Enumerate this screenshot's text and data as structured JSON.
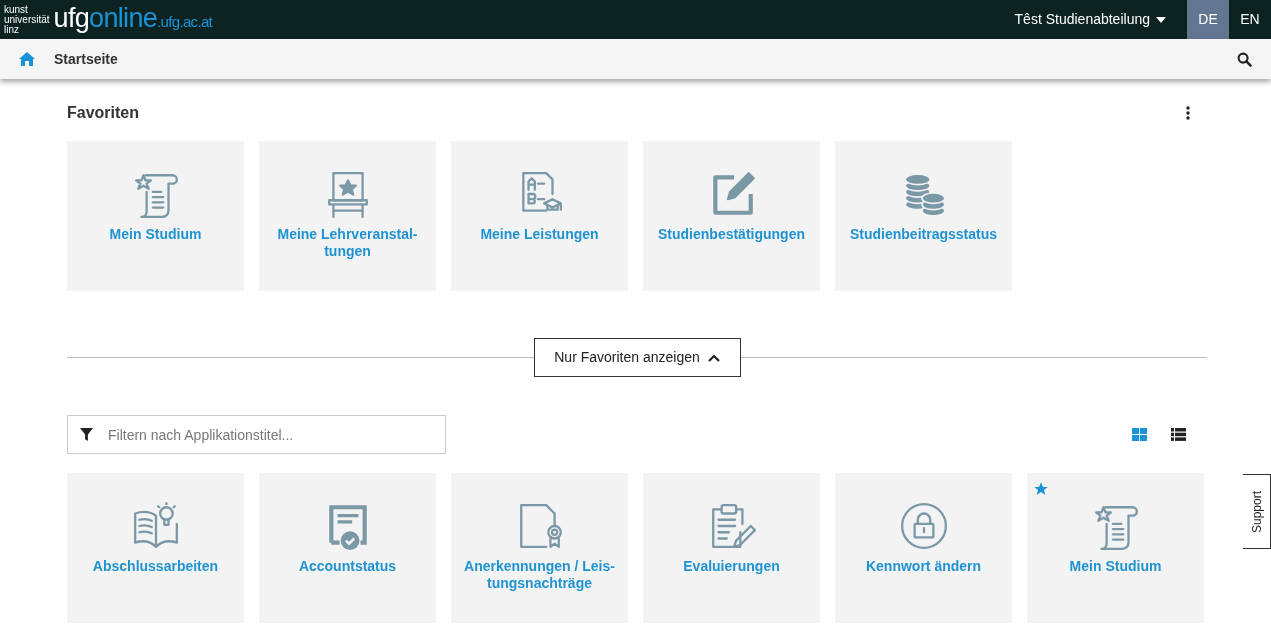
{
  "header": {
    "logo_small": "kunst\nuniversität\nlinz",
    "logo_main_a": "ufg",
    "logo_main_b": "online",
    "logo_domain": ".ufg.ac.at",
    "user": "Têst Studienabteilung",
    "languages": [
      {
        "label": "DE",
        "selected": true
      },
      {
        "label": "EN",
        "selected": false
      }
    ]
  },
  "nav": {
    "title": "Startseite"
  },
  "favorites": {
    "title": "Favoriten",
    "tiles": [
      {
        "label": "Mein Studium",
        "favorite": false
      },
      {
        "label": "Meine Lehrveranstal-\ntungen",
        "favorite": false
      },
      {
        "label": "Meine Leistungen",
        "favorite": false
      },
      {
        "label": "Studienbestätigungen",
        "favorite": false
      },
      {
        "label": "Studienbeitragsstatus",
        "favorite": false
      }
    ]
  },
  "toggle_button": "Nur Favoriten anzeigen",
  "filter": {
    "placeholder": "Filtern nach Applikationstitel..."
  },
  "views": [
    {
      "kind": "grid",
      "selected": true
    },
    {
      "kind": "list",
      "selected": false
    }
  ],
  "apps": [
    {
      "label": "Abschlussarbeiten",
      "favorite": false
    },
    {
      "label": "Accountstatus",
      "favorite": false
    },
    {
      "label": "Anerkennungen / Leis-\ntungsnachträge",
      "favorite": false
    },
    {
      "label": "Evaluierungen",
      "favorite": false
    },
    {
      "label": "Kennwort ändern",
      "favorite": false
    },
    {
      "label": "Mein Studium",
      "favorite": true
    }
  ],
  "support": "Support"
}
